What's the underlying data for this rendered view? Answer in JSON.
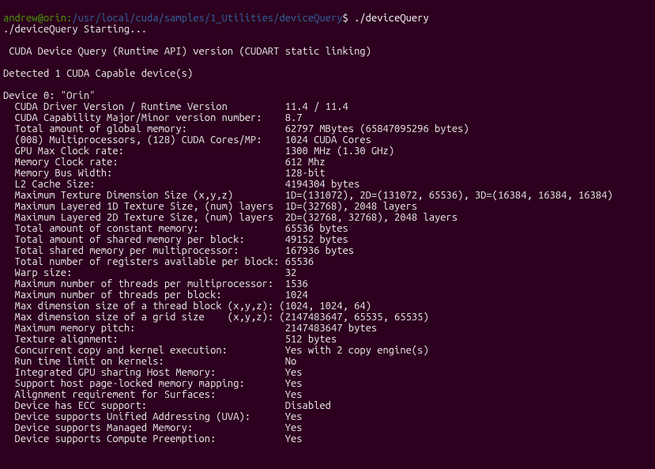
{
  "prompt": {
    "userhost": "andrew@orin",
    "sep": ":",
    "path": "/usr/local/cuda/samples/1_Utilities/deviceQuery",
    "dollar": "$ ",
    "cmd": "./deviceQuery"
  },
  "lines": {
    "starting": "./deviceQuery Starting...",
    "blank": "",
    "header": " CUDA Device Query (Runtime API) version (CUDART static linking)",
    "detected": "Detected 1 CUDA Capable device(s)",
    "device": "Device 0: \"Orin\"",
    "p01": "  CUDA Driver Version / Runtime Version          11.4 / 11.4",
    "p02": "  CUDA Capability Major/Minor version number:    8.7",
    "p03": "  Total amount of global memory:                 62797 MBytes (65847095296 bytes)",
    "p04": "  (008) Multiprocessors, (128) CUDA Cores/MP:    1024 CUDA Cores",
    "p05": "  GPU Max Clock rate:                            1300 MHz (1.30 GHz)",
    "p06": "  Memory Clock rate:                             612 Mhz",
    "p07": "  Memory Bus Width:                              128-bit",
    "p08": "  L2 Cache Size:                                 4194304 bytes",
    "p09": "  Maximum Texture Dimension Size (x,y,z)         1D=(131072), 2D=(131072, 65536), 3D=(16384, 16384, 16384)",
    "p10": "  Maximum Layered 1D Texture Size, (num) layers  1D=(32768), 2048 layers",
    "p11": "  Maximum Layered 2D Texture Size, (num) layers  2D=(32768, 32768), 2048 layers",
    "p12": "  Total amount of constant memory:               65536 bytes",
    "p13": "  Total amount of shared memory per block:       49152 bytes",
    "p14": "  Total shared memory per multiprocessor:        167936 bytes",
    "p15": "  Total number of registers available per block: 65536",
    "p16": "  Warp size:                                     32",
    "p17": "  Maximum number of threads per multiprocessor:  1536",
    "p18": "  Maximum number of threads per block:           1024",
    "p19": "  Max dimension size of a thread block (x,y,z): (1024, 1024, 64)",
    "p20": "  Max dimension size of a grid size    (x,y,z): (2147483647, 65535, 65535)",
    "p21": "  Maximum memory pitch:                          2147483647 bytes",
    "p22": "  Texture alignment:                             512 bytes",
    "p23": "  Concurrent copy and kernel execution:          Yes with 2 copy engine(s)",
    "p24": "  Run time limit on kernels:                     No",
    "p25": "  Integrated GPU sharing Host Memory:            Yes",
    "p26": "  Support host page-locked memory mapping:       Yes",
    "p27": "  Alignment requirement for Surfaces:            Yes",
    "p28": "  Device has ECC support:                        Disabled",
    "p29": "  Device supports Unified Addressing (UVA):      Yes",
    "p30": "  Device supports Managed Memory:                Yes",
    "p31": "  Device supports Compute Preemption:            Yes"
  }
}
